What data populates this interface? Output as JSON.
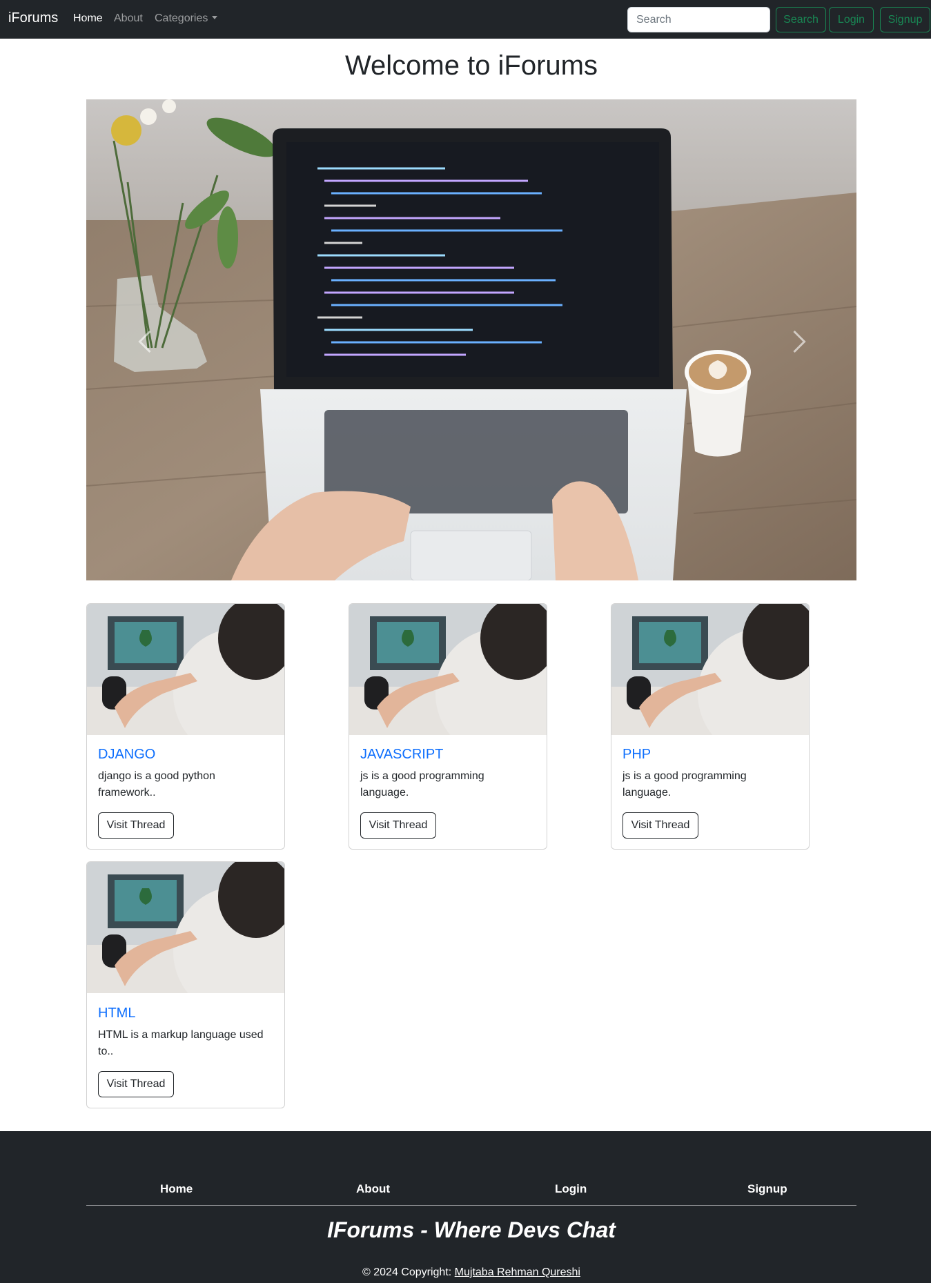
{
  "navbar": {
    "brand": "iForums",
    "links": [
      "Home",
      "About"
    ],
    "categories_label": "Categories",
    "search_placeholder": "Search",
    "search_button": "Search",
    "login_button": "Login",
    "signup_button": "Signup"
  },
  "main": {
    "title": "Welcome to iForums"
  },
  "cards": [
    {
      "title": "DJANGO",
      "text": "django is a good python framework..",
      "button": "Visit Thread"
    },
    {
      "title": "JAVASCRIPT",
      "text": "js is a good programming language.",
      "button": "Visit Thread"
    },
    {
      "title": "PHP",
      "text": "js is a good programming language.",
      "button": "Visit Thread"
    },
    {
      "title": "HTML",
      "text": "HTML is a markup language used to..",
      "button": "Visit Thread"
    }
  ],
  "footer": {
    "links": [
      "Home",
      "About",
      "Login",
      "Signup"
    ],
    "tagline": "IForums - Where Devs Chat",
    "copyright": "© 2024 Copyright:",
    "author": "Mujtaba Rehman Qureshi"
  },
  "colors": {
    "navbar_bg": "#212529",
    "success": "#198754",
    "card_title": "#0d6efd",
    "footer_bg": "#212529"
  },
  "icons": [
    "chevron-left-icon",
    "chevron-right-icon",
    "caret-down-icon"
  ]
}
